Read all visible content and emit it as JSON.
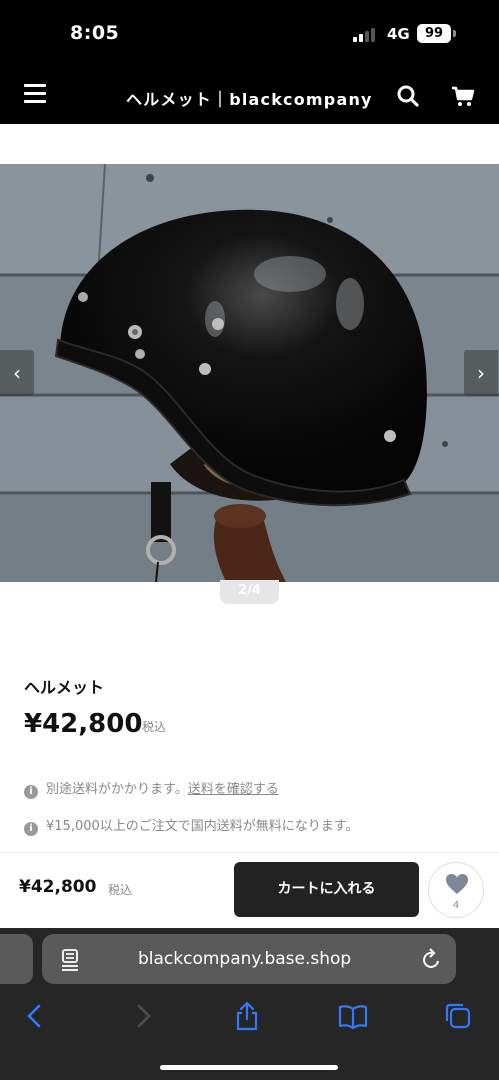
{
  "status_bar": {
    "time": "8:05",
    "network": "4G",
    "battery": "99"
  },
  "header": {
    "title": "ヘルメット｜blackcompany",
    "icons": [
      "menu-icon",
      "search-icon",
      "cart-icon"
    ]
  },
  "slider": {
    "counter": "2/4",
    "image": "black-helmet-photo",
    "prev_icon": "‹",
    "next_icon": "›"
  },
  "product": {
    "name": "ヘルメット",
    "price": "¥42,800",
    "tax_label": "税込",
    "shipping_note": "別途送料がかかります。",
    "shipping_link": "送料を確認する",
    "free_shipping_note": "¥15,000以上のご注文で国内送料が無料になります。"
  },
  "buy_bar": {
    "price": "¥42,800",
    "tax_label": "税込",
    "cart_button": "カートに入れる",
    "like_count": "4"
  },
  "browser": {
    "url": "blackcompany.base.shop"
  },
  "colors": {
    "header_bg": "#000000",
    "button_bg": "#232323",
    "safari_bg": "#262626",
    "accent_blue": "#3478f6"
  }
}
